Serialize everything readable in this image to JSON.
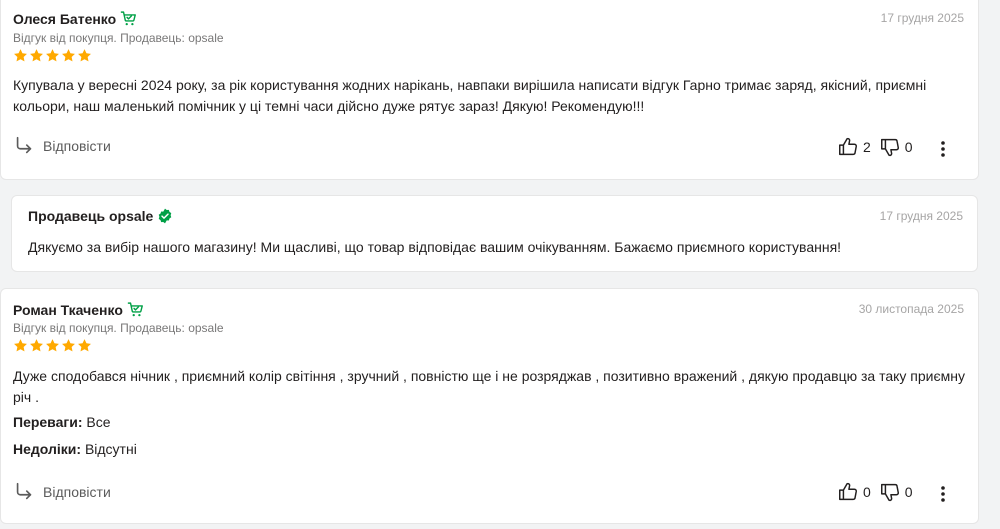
{
  "reviews": [
    {
      "author": "Олеся Батенко",
      "meta": "Відгук від покупця. Продавець: opsale",
      "date": "17 грудня 2025",
      "rating": 5,
      "text": "Купувала у вересні 2024 року, за рік користування жодних нарікань, навпаки вирішила написати відгук Гарно тримає заряд, якісний, приємні кольори, наш маленький помічник у ці темні часи дійсно дуже рятує зараз! Дякую! Рекомендую!!!",
      "reply_label": "Відповісти",
      "likes": "2",
      "dislikes": "0"
    },
    {
      "author": "Роман Ткаченко",
      "meta": "Відгук від покупця. Продавець: opsale",
      "date": "30 листопада 2025",
      "rating": 5,
      "text": "Дуже сподобався нічник , приємний колір світіння , зручний , повністю ще і не розряджав , позитивно вражений , дякую продавцю за таку приємну річ .",
      "pros_label": "Переваги:",
      "pros": "Все",
      "cons_label": "Недоліки:",
      "cons": "Відсутні",
      "reply_label": "Відповісти",
      "likes": "0",
      "dislikes": "0"
    }
  ],
  "seller_reply": {
    "title": "Продавець  opsale",
    "date": "17 грудня 2025",
    "text": "Дякуємо за вибір нашого магазину! Ми щасливі, що товар відповідає вашим очікуванням. Бажаємо приємного користування!"
  },
  "colors": {
    "star": "#ffa900",
    "badge_green": "#00a046",
    "text": "#221f1f",
    "muted": "#797878"
  },
  "icons": [
    "verified-buyer-cart-icon",
    "star-icon",
    "reply-arrow-icon",
    "thumb-up-icon",
    "thumb-down-icon",
    "more-vertical-icon",
    "verified-seller-check-icon"
  ]
}
